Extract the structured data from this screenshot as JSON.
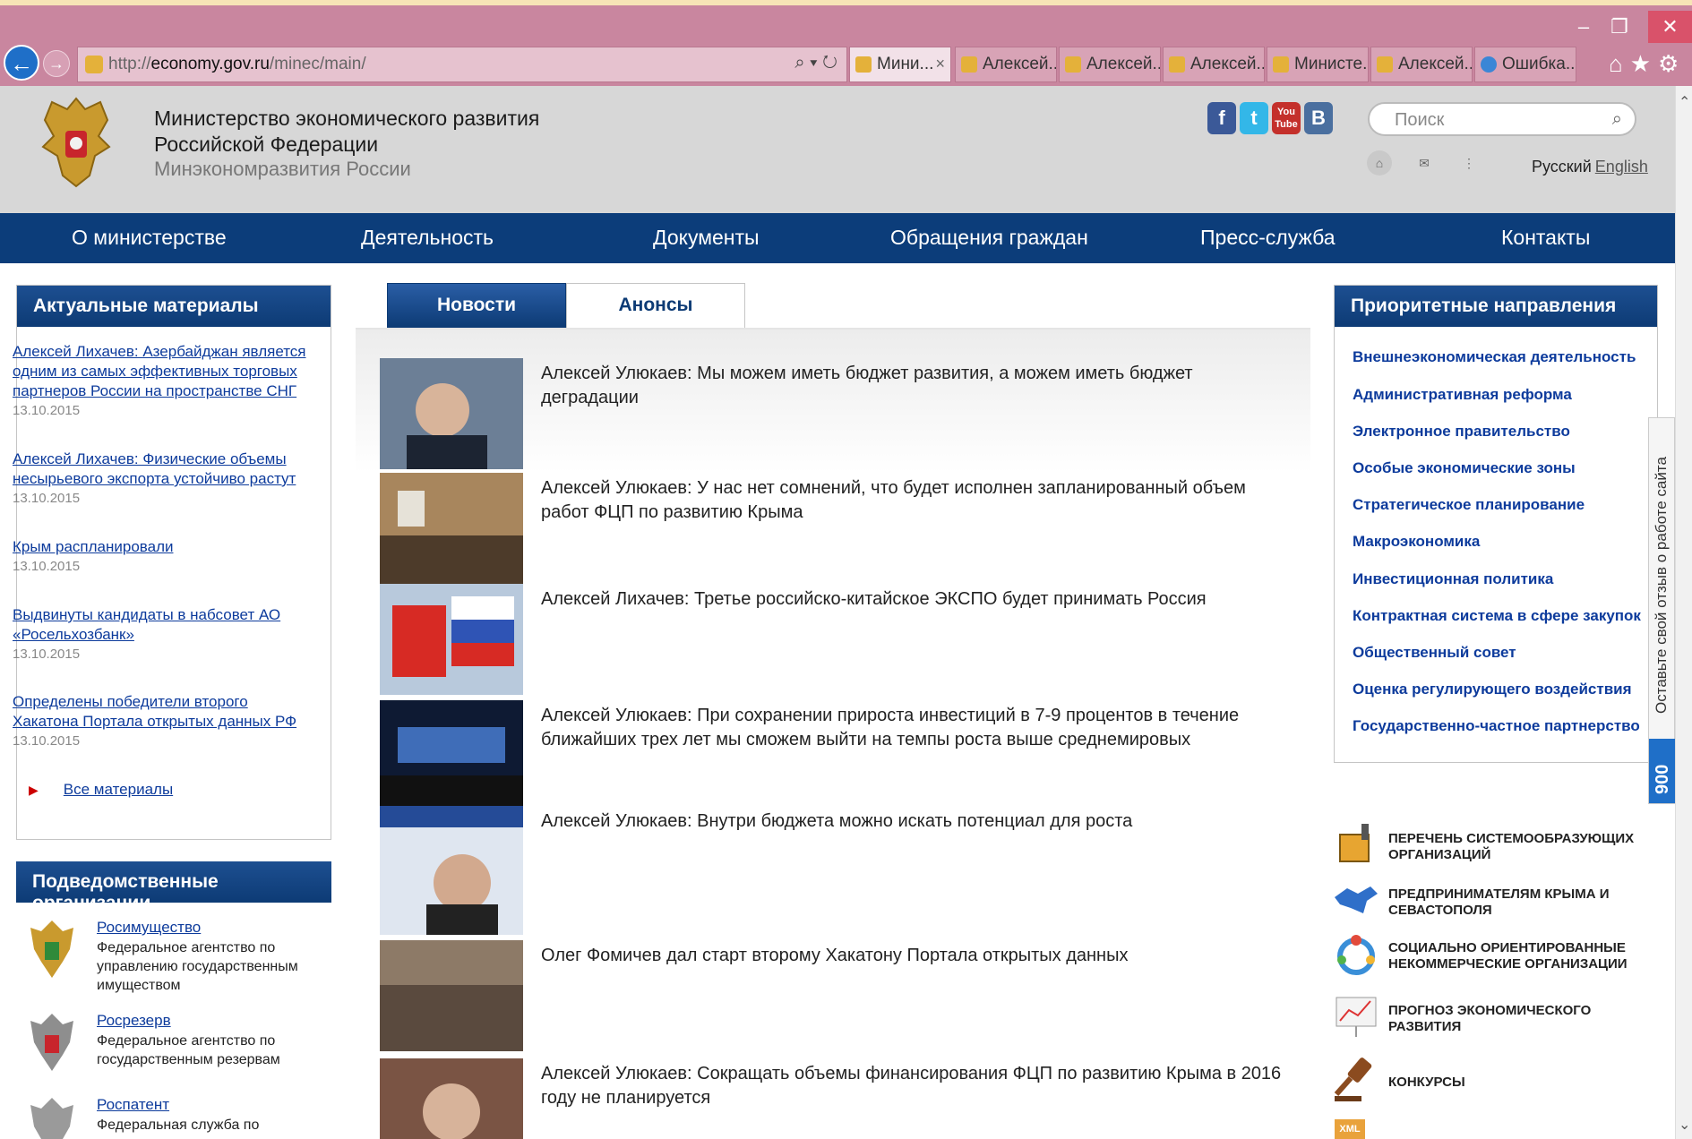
{
  "browser": {
    "url_host": "economy.gov.ru",
    "url_prefix": "http://",
    "url_path": "/minec/main/",
    "tabs": [
      "Мини...",
      "Алексей...",
      "Алексей...",
      "Алексей...",
      "Министе...",
      "Алексей...",
      "Ошибка..."
    ]
  },
  "header": {
    "title_line1": "Министерство экономического развития",
    "title_line2": "Российской Федерации",
    "subtitle": "Минэкономразвития России",
    "search_placeholder": "Поиск",
    "lang_ru": "Русский",
    "lang_en": "English",
    "social": [
      "f",
      "t",
      "You Tube",
      "B"
    ]
  },
  "menu": [
    "О министерстве",
    "Деятельность",
    "Документы",
    "Обращения граждан",
    "Пресс-служба",
    "Контакты"
  ],
  "left": {
    "materials_title": "Актуальные материалы",
    "materials": [
      {
        "title": "Алексей Лихачев: Азербайджан является одним из самых эффективных торговых партнеров России на пространстве СНГ",
        "date": "13.10.2015"
      },
      {
        "title": "Алексей Лихачев: Физические объемы несырьевого экспорта устойчиво растут",
        "date": "13.10.2015"
      },
      {
        "title": "Крым распланировали",
        "date": "13.10.2015"
      },
      {
        "title": "Выдвинуты кандидаты в набсовет АО «Росельхозбанк»",
        "date": "13.10.2015"
      },
      {
        "title": "Определены победители второго Хакатона Портала открытых данных РФ",
        "date": "13.10.2015"
      }
    ],
    "all_materials": "Все материалы",
    "orgs_title": "Подведомственные организации",
    "orgs": [
      {
        "name": "Росимущество",
        "desc": "Федеральное агентство по управлению государственным имуществом"
      },
      {
        "name": "Росрезерв",
        "desc": "Федеральное агентство по государственным резервам"
      },
      {
        "name": "Роспатент",
        "desc": "Федеральная служба по"
      }
    ]
  },
  "center": {
    "tab_news": "Новости",
    "tab_announce": "Анонсы",
    "news": [
      "Алексей Улюкаев: Мы можем иметь бюджет развития, а можем иметь бюджет деградации",
      "Алексей Улюкаев: У нас нет сомнений, что будет исполнен запланированный объем работ ФЦП по развитию Крыма",
      "Алексей Лихачев: Третье российско-китайское ЭКСПО будет принимать Россия",
      "Алексей Улюкаев: При сохранении прироста инвестиций в 7-9 процентов в течение ближайших трех лет мы сможем выйти на темпы роста выше среднемировых",
      "Алексей Улюкаев: Внутри бюджета можно искать потенциал для роста",
      "Олег Фомичев дал старт второму Хакатону Портала открытых данных",
      "Алексей Улюкаев: Сокращать объемы финансирования ФЦП по развитию Крыма в 2016 году не планируется"
    ]
  },
  "right": {
    "priority_title": "Приоритетные направления",
    "priorities": [
      "Внешнеэкономическая деятельность",
      "Административная реформа",
      "Электронное правительство",
      "Особые экономические зоны",
      "Стратегическое планирование",
      "Макроэкономика",
      "Инвестиционная политика",
      "Контрактная система в сфере закупок",
      "Общественный совет",
      "Оценка регулирующего воздействия",
      "Государственно-частное партнерство"
    ],
    "feedback_text": "Оставьте свой отзыв о работе сайта",
    "feedback_badge": "900",
    "promos": [
      "ПЕРЕЧЕНЬ СИСТЕМООБРАЗУЮЩИХ ОРГАНИЗАЦИЙ",
      "ПРЕДПРИНИМАТЕЛЯМ КРЫМА И СЕВАСТОПОЛЯ",
      "СОЦИАЛЬНО ОРИЕНТИРОВАННЫЕ НЕКОММЕРЧЕСКИЕ ОРГАНИЗАЦИИ",
      "ПРОГНОЗ ЭКОНОМИЧЕСКОГО РАЗВИТИЯ",
      "КОНКУРСЫ"
    ],
    "xml_label": "XML"
  },
  "colors": {
    "brand_blue": "#0c3d7a",
    "link_blue": "#0d3b9c",
    "browser_chrome": "#c9869f"
  }
}
